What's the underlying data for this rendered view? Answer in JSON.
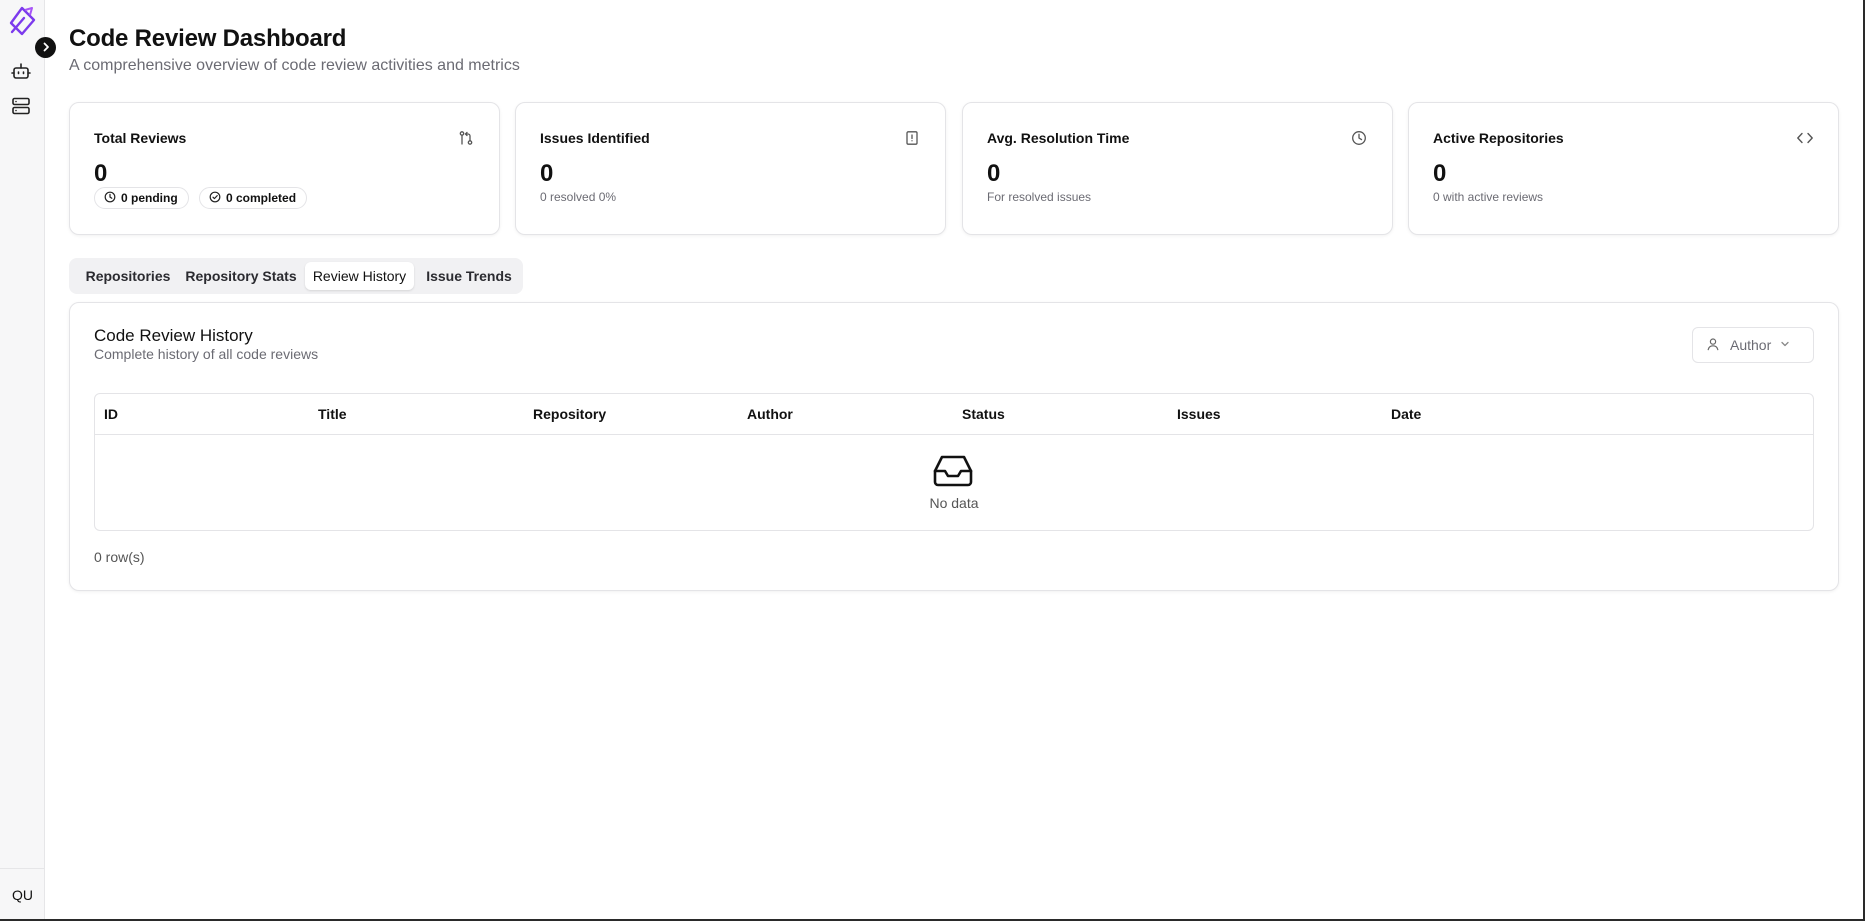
{
  "sidebar": {
    "user_initials": "QU",
    "items": [
      {
        "icon": "bot-icon"
      },
      {
        "icon": "server-icon"
      }
    ],
    "brand_color": "#7c3aed"
  },
  "header": {
    "title": "Code Review Dashboard",
    "subtitle": "A comprehensive overview of code review activities and metrics"
  },
  "stats": {
    "total_reviews": {
      "title": "Total Reviews",
      "value": "0",
      "pending": "0 pending",
      "completed": "0 completed",
      "icon": "git-pull-request-icon"
    },
    "issues_identified": {
      "title": "Issues Identified",
      "value": "0",
      "sub": "0 resolved 0%",
      "icon": "file-alert-icon"
    },
    "avg_resolution": {
      "title": "Avg. Resolution Time",
      "value": "0",
      "sub": "For resolved issues",
      "icon": "clock-icon"
    },
    "active_repos": {
      "title": "Active Repositories",
      "value": "0",
      "sub": "0 with active reviews",
      "icon": "code-icon"
    }
  },
  "tabs": [
    {
      "label": "Repositories",
      "active": false
    },
    {
      "label": "Repository Stats",
      "active": false
    },
    {
      "label": "Review History",
      "active": true
    },
    {
      "label": "Issue Trends",
      "active": false
    }
  ],
  "history": {
    "title": "Code Review History",
    "description": "Complete history of all code reviews",
    "author_filter": "Author",
    "columns": [
      "ID",
      "Title",
      "Repository",
      "Author",
      "Status",
      "Issues",
      "Date"
    ],
    "empty_text": "No data",
    "row_count": "0 row(s)"
  }
}
